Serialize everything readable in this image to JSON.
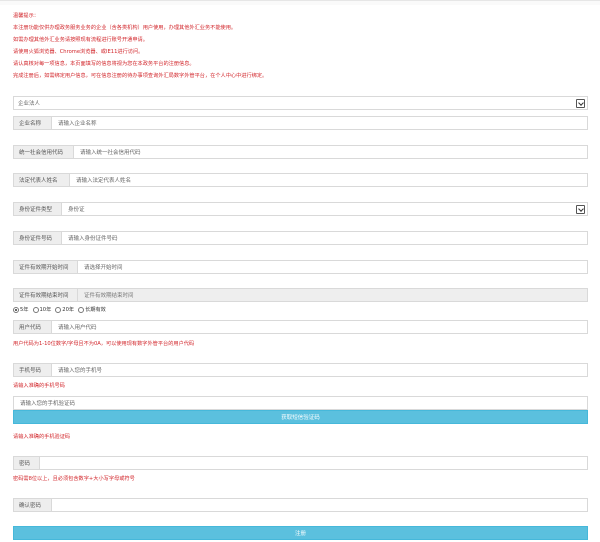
{
  "notice": {
    "title": "温馨提示：",
    "lines": [
      "本注册功能仅供办理政务服务业务的企业（含各类机构）用户使用，办理其他外汇业务不能使用。",
      "如需办理其他外汇业务请按照现有流程进行账号开通申请。",
      "请使用火狐浏览器、Chrome浏览器、或IE11进行访问。",
      "请认真核对每一项信息，本页面填写的信息将视为您在本政务平台的注册信息。",
      "完成注册后，如需绑定用户信息，可在信息注册的待办事项查询外汇局数字外管平台，在个人中心中进行绑定。"
    ]
  },
  "form": {
    "org_type": {
      "value": "企业法人"
    },
    "company_name": {
      "label": "企业名称",
      "placeholder": "请输入企业名称"
    },
    "credit_code": {
      "label": "统一社会信用代码",
      "placeholder": "请输入统一社会信用代码"
    },
    "legal_rep": {
      "label": "法定代表人姓名",
      "placeholder": "请输入法定代表人姓名"
    },
    "id_type": {
      "label": "身份证件类型",
      "value": "身份证"
    },
    "id_number": {
      "label": "身份证件号码",
      "placeholder": "请输入身份证件号码"
    },
    "valid_start": {
      "label": "证件有效期开始时间",
      "placeholder": "请选择开始时间"
    },
    "valid_end": {
      "label": "证件有效期结束时间",
      "placeholder": "证件有效期结束时间"
    },
    "validity_options": [
      "5年",
      "10年",
      "20年",
      "长期有效"
    ],
    "user_code": {
      "label": "用户代码",
      "placeholder": "请输入用户代码"
    },
    "user_code_hint": "用户代码为1-10位数字/字母且不为0A，可以使用现有数字外管平台的用户代码",
    "phone": {
      "label": "手机号码",
      "placeholder": "请输入您的手机号"
    },
    "phone_error": "请输入准确的手机号码",
    "sms_code": {
      "placeholder": "请输入您的手机验证码"
    },
    "get_code_button": "获取短信验证码",
    "sms_error": "请输入准确的手机验证码",
    "password": {
      "label": "密码",
      "placeholder": ""
    },
    "password_hint": "密码需8位以上，且必须包含数字+大小写字母或符号",
    "confirm_password": {
      "label": "确认密码",
      "placeholder": ""
    },
    "submit_button": "注册"
  }
}
